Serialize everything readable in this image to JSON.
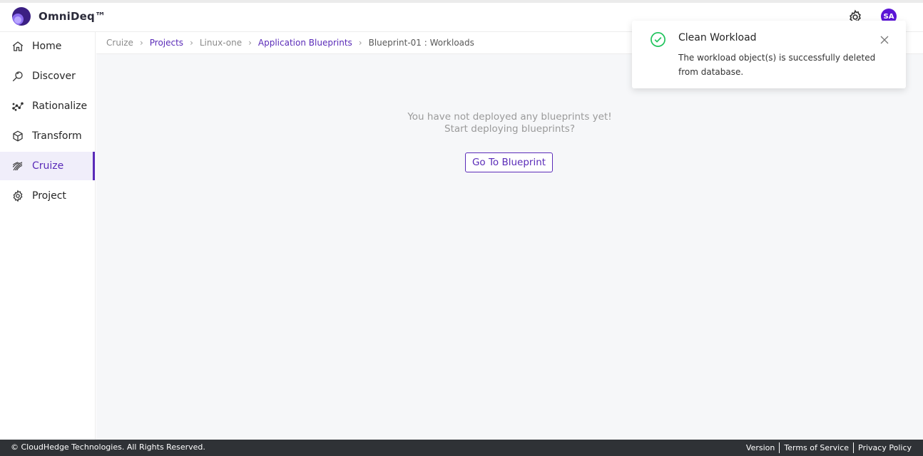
{
  "header": {
    "brand": "OmniDeq™",
    "avatar_initials": "SA",
    "settings_icon": "gear-icon",
    "accent_color": "#5a2bb8"
  },
  "sidebar": {
    "items": [
      {
        "label": "Home",
        "icon": "home-icon",
        "active": false
      },
      {
        "label": "Discover",
        "icon": "discover-icon",
        "active": false
      },
      {
        "label": "Rationalize",
        "icon": "rationalize-icon",
        "active": false
      },
      {
        "label": "Transform",
        "icon": "transform-cube-icon",
        "active": false
      },
      {
        "label": "Cruize",
        "icon": "cruize-icon",
        "active": true
      },
      {
        "label": "Project",
        "icon": "project-gear-icon",
        "active": false
      }
    ]
  },
  "breadcrumb": {
    "items": [
      {
        "label": "Cruize",
        "type": "plain"
      },
      {
        "label": "Projects",
        "type": "link"
      },
      {
        "label": "Linux-one",
        "type": "plain"
      },
      {
        "label": "Application Blueprints",
        "type": "link"
      },
      {
        "label": "Blueprint-01 : Workloads",
        "type": "current"
      }
    ]
  },
  "main": {
    "empty_line1": "You have not deployed any blueprints yet!",
    "empty_line2": "Start deploying blueprints?",
    "go_button": "Go To Blueprint"
  },
  "toast": {
    "title": "Clean Workload",
    "message": "The workload object(s) is successfully deleted from database.",
    "status_color": "#21c45d"
  },
  "footer": {
    "copyright": "© CloudHedge Technologies. All Rights Reserved.",
    "links": [
      "Version",
      "Terms of Service",
      "Privacy Policy"
    ]
  }
}
